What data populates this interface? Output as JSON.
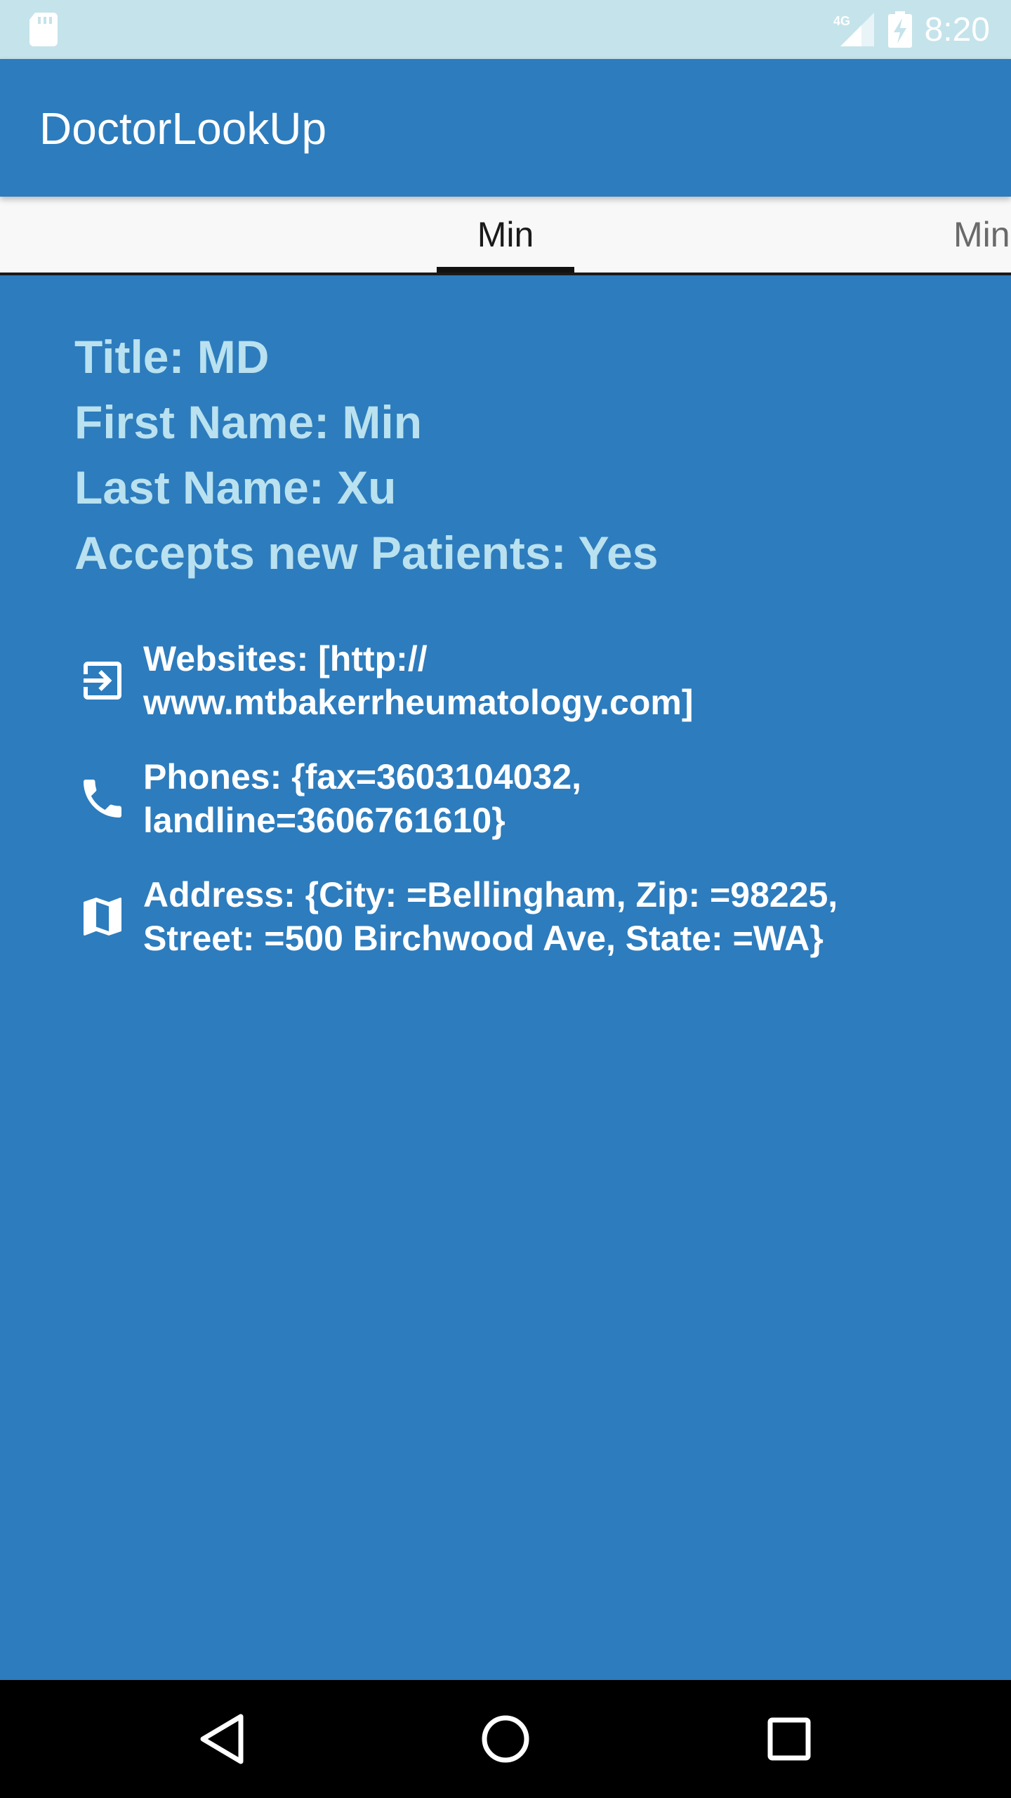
{
  "status_bar": {
    "network": "4G",
    "time": "8:20",
    "icons": [
      "sd-card-icon",
      "signal-icon",
      "battery-charging-icon"
    ]
  },
  "app_bar": {
    "title": "DoctorLookUp"
  },
  "tabs": [
    {
      "label": "Min",
      "active": true
    },
    {
      "label": "Min",
      "active": false
    }
  ],
  "doctor": {
    "title_line": "Title: MD",
    "first_name_line": "First Name: Min",
    "last_name_line": "Last Name: Xu",
    "accepts_line": "Accepts new Patients: Yes"
  },
  "details": {
    "websites": "Websites: [http://\nwww.mtbakerrheumatology.com]",
    "phones": "Phones: {fax=3603104032,\nlandline=3606761610}",
    "address": "Address: {City: =Bellingham, Zip: =98225,\nStreet: =500 Birchwood Ave, State: =WA}"
  },
  "colors": {
    "primary": "#2d7cbd",
    "status_bar": "#c5e3ea",
    "info_text": "#b9e1ef",
    "tab_bar": "#f8f8f8"
  },
  "nav_bar": {
    "icons": [
      "back-icon",
      "home-icon",
      "recents-icon"
    ]
  }
}
